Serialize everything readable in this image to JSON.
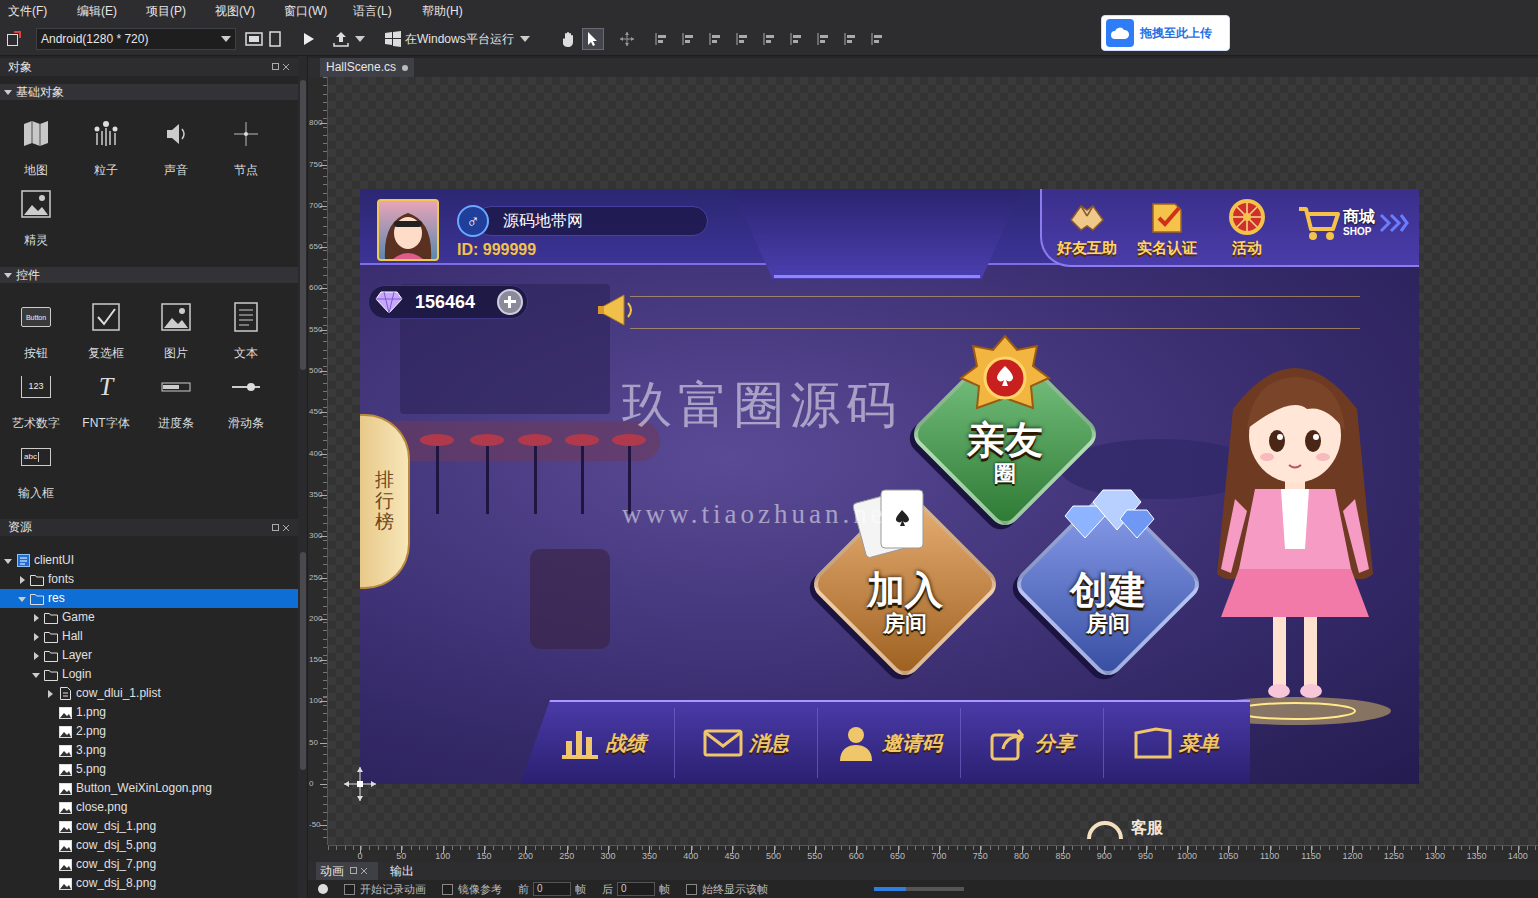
{
  "menu": [
    "文件(F)",
    "编辑(E)",
    "项目(P)",
    "视图(V)",
    "窗口(W)",
    "语言(L)",
    "帮助(H)"
  ],
  "toolbar": {
    "resolution": "Android(1280 * 720)",
    "run_target": "在Windows平台运行",
    "upload": "拖拽至此上传",
    "tools": [
      {
        "kind": "hand",
        "selected": false
      },
      {
        "kind": "pointer",
        "selected": true
      }
    ]
  },
  "objects_panel": {
    "title": "对象",
    "sections": [
      {
        "title": "基础对象",
        "expanded": true,
        "items": [
          {
            "label": "地图",
            "kind": "map"
          },
          {
            "label": "粒子",
            "kind": "particle"
          },
          {
            "label": "声音",
            "kind": "sound"
          },
          {
            "label": "节点",
            "kind": "node"
          },
          {
            "label": "精灵",
            "kind": "sprite"
          }
        ]
      },
      {
        "title": "控件",
        "expanded": true,
        "items": [
          {
            "label": "按钮",
            "kind": "button",
            "icon_text": "Button"
          },
          {
            "label": "复选框",
            "kind": "checkbox"
          },
          {
            "label": "图片",
            "kind": "image"
          },
          {
            "label": "文本",
            "kind": "text"
          },
          {
            "label": "艺术数字",
            "kind": "atlas",
            "icon_text": "123"
          },
          {
            "label": "FNT字体",
            "kind": "fnt",
            "icon_text": "T"
          },
          {
            "label": "进度条",
            "kind": "progress"
          },
          {
            "label": "滑动条",
            "kind": "slider"
          },
          {
            "label": "输入框",
            "kind": "input",
            "icon_text": "abc"
          }
        ]
      }
    ]
  },
  "resources_panel": {
    "title": "资源",
    "tree": [
      {
        "label": "clientUI",
        "depth": 0,
        "kind": "project",
        "expanded": true,
        "selected": false
      },
      {
        "label": "fonts",
        "depth": 1,
        "kind": "folder",
        "expanded": false,
        "selected": false
      },
      {
        "label": "res",
        "depth": 1,
        "kind": "folder",
        "expanded": true,
        "selected": true
      },
      {
        "label": "Game",
        "depth": 2,
        "kind": "folder",
        "expanded": false,
        "selected": false
      },
      {
        "label": "Hall",
        "depth": 2,
        "kind": "folder",
        "expanded": false,
        "selected": false
      },
      {
        "label": "Layer",
        "depth": 2,
        "kind": "folder",
        "expanded": false,
        "selected": false
      },
      {
        "label": "Login",
        "depth": 2,
        "kind": "folder",
        "expanded": true,
        "selected": false
      },
      {
        "label": "cow_dlui_1.plist",
        "depth": 3,
        "kind": "plist",
        "expanded": false,
        "selected": false
      },
      {
        "label": "1.png",
        "depth": 3,
        "kind": "image",
        "selected": false
      },
      {
        "label": "2.png",
        "depth": 3,
        "kind": "image",
        "selected": false
      },
      {
        "label": "3.png",
        "depth": 3,
        "kind": "image",
        "selected": false
      },
      {
        "label": "5.png",
        "depth": 3,
        "kind": "image",
        "selected": false
      },
      {
        "label": "Button_WeiXinLogon.png",
        "depth": 3,
        "kind": "image",
        "selected": false
      },
      {
        "label": "close.png",
        "depth": 3,
        "kind": "image",
        "selected": false
      },
      {
        "label": "cow_dsj_1.png",
        "depth": 3,
        "kind": "image",
        "selected": false
      },
      {
        "label": "cow_dsj_5.png",
        "depth": 3,
        "kind": "image",
        "selected": false
      },
      {
        "label": "cow_dsj_7.png",
        "depth": 3,
        "kind": "image",
        "selected": false
      },
      {
        "label": "cow_dsj_8.png",
        "depth": 3,
        "kind": "image",
        "selected": false
      }
    ]
  },
  "editor_tabs": [
    {
      "label": "HallScene.cs",
      "selected": true,
      "modified": true
    }
  ],
  "rulers": {
    "x": [
      "0",
      "50",
      "100",
      "150",
      "200",
      "250",
      "300",
      "350",
      "400",
      "450",
      "500",
      "550",
      "600",
      "650",
      "700",
      "750",
      "800",
      "850",
      "900",
      "950",
      "1000",
      "1050",
      "1100",
      "1150",
      "1200",
      "1250",
      "1300",
      "1350",
      "1400"
    ],
    "y": [
      "800",
      "750",
      "700",
      "650",
      "600",
      "550",
      "500",
      "450",
      "400",
      "350",
      "300",
      "250",
      "200",
      "150",
      "100",
      "50",
      "0",
      "-50"
    ]
  },
  "scene": {
    "player": {
      "gender_icon": "♂",
      "name": "源码地带网",
      "id": "ID: 999999"
    },
    "diamonds": "156464",
    "top_actions": [
      {
        "label": "好友互助",
        "kind": "handshake"
      },
      {
        "label": "实名认证",
        "kind": "verify"
      },
      {
        "label": "活动",
        "kind": "wheel"
      },
      {
        "label": "商城",
        "sub": "SHOP",
        "kind": "shop"
      }
    ],
    "rank_tab": "排行榜",
    "main_buttons": [
      {
        "title": "亲友",
        "sub": "圈",
        "color": "#3fae4a",
        "kind": "crest"
      },
      {
        "title": "加入",
        "sub": "房间",
        "color": "#e0892e",
        "kind": "cards"
      },
      {
        "title": "创建",
        "sub": "房间",
        "color": "#4f6fe6",
        "kind": "gems"
      }
    ],
    "bottom_menu": [
      {
        "label": "战绩",
        "kind": "chart"
      },
      {
        "label": "消息",
        "kind": "mail"
      },
      {
        "label": "邀请码",
        "kind": "person"
      },
      {
        "label": "分享",
        "kind": "share"
      },
      {
        "label": "菜单",
        "kind": "folder"
      }
    ],
    "watermark": {
      "title": "玖富圈源码",
      "url": "www.tiaozhuan.net"
    }
  },
  "off_canvas": {
    "label": "客服"
  },
  "bottom_panel": {
    "tabs": [
      {
        "label": "动画",
        "selected": true
      },
      {
        "label": "输出",
        "selected": false
      }
    ],
    "controls": [
      {
        "kind": "checkbox",
        "label": "开始记录动画",
        "checked": false
      },
      {
        "kind": "checkbox",
        "label": "镜像参考",
        "checked": false
      },
      {
        "kind": "frame",
        "prefix": "前",
        "value": "0",
        "suffix": "帧"
      },
      {
        "kind": "frame",
        "prefix": "后",
        "value": "0",
        "suffix": "帧"
      },
      {
        "kind": "checkbox",
        "label": "始终显示该帧",
        "checked": false
      },
      {
        "kind": "slider",
        "level": 0.35
      }
    ]
  }
}
